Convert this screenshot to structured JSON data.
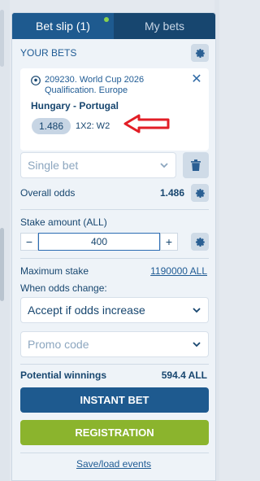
{
  "tabs": [
    {
      "label": "Bet slip (1)",
      "active": true
    },
    {
      "label": "My bets",
      "active": false
    }
  ],
  "section_title": "YOUR BETS",
  "bet": {
    "event_id": "209230. World Cup 2026 Qualification. Europe",
    "teams": "Hungary - Portugal",
    "odds": "1.486",
    "market": "1X2: W2"
  },
  "bet_type": {
    "selected": "Single bet"
  },
  "overall_odds": {
    "label": "Overall odds",
    "value": "1.486"
  },
  "stake": {
    "label": "Stake amount (ALL)",
    "minus": "−",
    "value": "400",
    "plus": "+"
  },
  "max_stake": {
    "label": "Maximum stake",
    "value": "1190000 ALL"
  },
  "odds_change": {
    "label": "When odds change:",
    "selected": "Accept if odds increase"
  },
  "promo": {
    "placeholder": "Promo code"
  },
  "potential": {
    "label": "Potential winnings",
    "value": "594.4 ALL"
  },
  "buttons": {
    "instant_bet": "INSTANT BET",
    "registration": "REGISTRATION"
  },
  "footer": {
    "save_load": "Save/load events"
  },
  "icons": {
    "settings": "gear-icon",
    "delete": "trash-icon",
    "close": "close-icon",
    "sport": "soccer-ball-icon",
    "dropdown": "chevron-down-icon",
    "annotation": "red-arrow-icon"
  },
  "colors": {
    "header": "#17466f",
    "active_tab": "#1e5a8f",
    "instant_bet": "#1e5a8f",
    "registration": "#8bb42d",
    "notification_dot": "#89d24f",
    "annotation_arrow": "#e21e26"
  }
}
